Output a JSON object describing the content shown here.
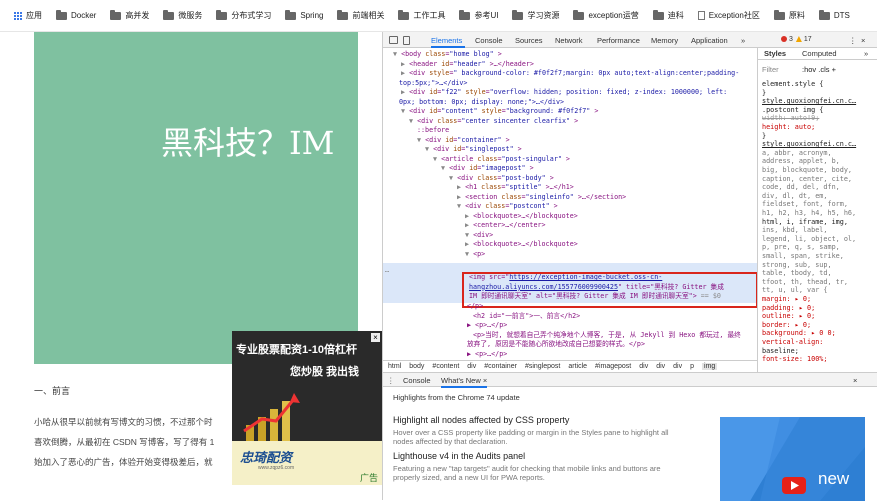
{
  "bookmarks": [
    {
      "label": "应用",
      "icon": "apps-grid-icon"
    },
    {
      "label": "Docker",
      "icon": "folder-icon"
    },
    {
      "label": "高并发",
      "icon": "folder-icon"
    },
    {
      "label": "微服务",
      "icon": "folder-icon"
    },
    {
      "label": "分布式学习",
      "icon": "folder-icon"
    },
    {
      "label": "Spring",
      "icon": "folder-icon"
    },
    {
      "label": "前端相关",
      "icon": "folder-icon"
    },
    {
      "label": "工作工具",
      "icon": "folder-icon"
    },
    {
      "label": "参考UI",
      "icon": "folder-icon"
    },
    {
      "label": "学习资源",
      "icon": "folder-icon"
    },
    {
      "label": "exception运营",
      "icon": "folder-icon"
    },
    {
      "label": "迪科",
      "icon": "folder-icon"
    },
    {
      "label": "Exception社区",
      "icon": "page-icon"
    },
    {
      "label": "原料",
      "icon": "folder-icon"
    },
    {
      "label": "DTS",
      "icon": "folder-icon"
    }
  ],
  "page": {
    "hero_title": "黑科技？IM",
    "section_heading": "一、前言",
    "paragraphs": [
      "小哈从很早以前就有写博文的习惯，不过那个时",
      "喜欢倒腾，从最初在 CSDN 写博客，写了得有 1",
      "始加入了恶心的广告，体验开始变得极差后，就"
    ],
    "colors": {
      "hero_bg": "#7fc1a0"
    }
  },
  "ad": {
    "line1": "专业股票配资1-10倍杠杆",
    "line2": "您炒股 我出钱",
    "brand": "忠琦配资",
    "url": "www.zqpz6.com",
    "tag": "广告",
    "close": "×"
  },
  "devtools": {
    "tabs": [
      "Elements",
      "Console",
      "Sources",
      "Network",
      "Performance",
      "Memory",
      "Application",
      "»"
    ],
    "active_tab": "Elements",
    "errors": "3",
    "warnings": "17",
    "more": "⋮",
    "close": "×",
    "elements_lines": [
      {
        "indent": 0,
        "arrow": "▼",
        "tag": "<body ",
        "attrs": [
          [
            "class",
            "\"home blog\""
          ]
        ],
        "tail": ">"
      },
      {
        "indent": 1,
        "arrow": "▶",
        "tag": "<header ",
        "attrs": [
          [
            "id",
            "\"header\""
          ]
        ],
        "tail": ">…</header>"
      },
      {
        "indent": 1,
        "arrow": "▶",
        "tag": "<div ",
        "attrs": [
          [
            "style",
            "\" background-color: #f0f2f7;margin: 0px auto;text-align:center;padding-"
          ]
        ],
        "tail": ""
      },
      {
        "indent": 0,
        "arrow": "",
        "tag": "",
        "attrs": [],
        "tail": "top:5px;\">…</div>",
        "plain": true
      },
      {
        "indent": 1,
        "arrow": "▶",
        "tag": "<div ",
        "attrs": [
          [
            "id",
            "\"f22\""
          ],
          [
            "style",
            "\"overflow: hidden; position: fixed; z-index: 1000000; left:"
          ]
        ],
        "tail": ""
      },
      {
        "indent": 0,
        "arrow": "",
        "tag": "",
        "attrs": [],
        "tail": "0px; bottom: 0px; display: none;\">…</div>",
        "plain": true
      },
      {
        "indent": 1,
        "arrow": "▼",
        "tag": "<div ",
        "attrs": [
          [
            "id",
            "\"content\""
          ],
          [
            "style",
            "\"background: #f0f2f7\""
          ]
        ],
        "tail": ">"
      },
      {
        "indent": 2,
        "arrow": "▼",
        "tag": "<div ",
        "attrs": [
          [
            "class",
            "\"center sincenter clearfix\""
          ]
        ],
        "tail": ">"
      },
      {
        "indent": 3,
        "arrow": "",
        "tag": "::before",
        "attrs": [],
        "tail": ""
      },
      {
        "indent": 3,
        "arrow": "▼",
        "tag": "<div ",
        "attrs": [
          [
            "id",
            "\"container\""
          ]
        ],
        "tail": ">"
      },
      {
        "indent": 4,
        "arrow": "▼",
        "tag": "<div ",
        "attrs": [
          [
            "id",
            "\"singlepost\""
          ]
        ],
        "tail": ">"
      },
      {
        "indent": 5,
        "arrow": "▼",
        "tag": "<article ",
        "attrs": [
          [
            "class",
            "\"post-singular\""
          ]
        ],
        "tail": ">"
      },
      {
        "indent": 6,
        "arrow": "▼",
        "tag": "<div ",
        "attrs": [
          [
            "id",
            "\"imagepost\""
          ]
        ],
        "tail": ">"
      },
      {
        "indent": 7,
        "arrow": "▼",
        "tag": "<div ",
        "attrs": [
          [
            "class",
            "\"post-body\""
          ]
        ],
        "tail": ">"
      },
      {
        "indent": 8,
        "arrow": "▶",
        "tag": "<h1 ",
        "attrs": [
          [
            "class",
            "\"sptitle\""
          ]
        ],
        "tail": ">…</h1>"
      },
      {
        "indent": 8,
        "arrow": "▶",
        "tag": "<section ",
        "attrs": [
          [
            "class",
            "\"singleinfo\""
          ]
        ],
        "tail": ">…</section>"
      },
      {
        "indent": 8,
        "arrow": "▼",
        "tag": "<div ",
        "attrs": [
          [
            "class",
            "\"postcont\""
          ]
        ],
        "tail": ">"
      },
      {
        "indent": 9,
        "arrow": "▶",
        "tag": "<blockquote>",
        "attrs": [],
        "tail": "…</blockquote>"
      },
      {
        "indent": 9,
        "arrow": "▶",
        "tag": "<center>",
        "attrs": [],
        "tail": "…</center>"
      },
      {
        "indent": 9,
        "arrow": "▼",
        "tag": "<div>",
        "attrs": [],
        "tail": ""
      },
      {
        "indent": 9,
        "arrow": "▶",
        "tag": "<blockquote>",
        "attrs": [],
        "tail": "…</blockquote>"
      },
      {
        "indent": 9,
        "arrow": "▼",
        "tag": "<p>",
        "attrs": [],
        "tail": ""
      }
    ],
    "img_line1_pre": "<img src=\"",
    "img_link1": "https://exception-image-bucket.oss-cn-",
    "img_link2": "hangzhou.aliyuncs.com/155776009900425",
    "img_line2_tail": "\" title=\"黑科技? Gitter 集成",
    "img_line3": "IM 即时通讯聊天室\" alt=\"黑科技? Gitter 集成 IM 即时通讯聊天室\">",
    "img_line3_eq": " == $0",
    "after_lines": [
      "</p>",
      "<h2 id=\"一前言\">一、前言</h2>",
      "▶ <p>…</p>",
      "<p>当时, 就想着自己弄个纯净地个人博客, 于是, 从 Jekyll 到 Hexo 都玩过, 最终",
      "放弃了, 原因是不能随心所欲地改成自己想要的样式。</p>",
      "▶ <p>…</p>",
      "▶ <p>…</p>",
      "<p>好了, 说了这么多废话, 开始进入正题. 由于网站有留言, 聊天的功能, 导致与很多"
    ],
    "breadcrumbs": [
      "html",
      "body",
      "#content",
      "div",
      "#container",
      "#singlepost",
      "article",
      "#imagepost",
      "div",
      "div",
      "div",
      "p",
      "img"
    ],
    "styles": {
      "tabs": [
        "Styles",
        "Computed",
        "»"
      ],
      "filter_placeholder": "Filter",
      "hov_cls": ":hov  .cls  +",
      "lines": [
        {
          "t": "element.style {",
          "c": "tx"
        },
        {
          "t": "}",
          "c": "tx"
        },
        {
          "t": "style.guoxiongfei.cn.c…",
          "c": "lnk"
        },
        {
          "t": ".postcont img {",
          "c": "tx"
        },
        {
          "t": "  width: auto!9;",
          "c": "strike"
        },
        {
          "t": "  height: auto;",
          "c": "prop"
        },
        {
          "t": "}",
          "c": "tx"
        },
        {
          "t": "style.guoxiongfei.cn.c…",
          "c": "lnk"
        },
        {
          "t": "a, abbr, acronym,",
          "c": "gr"
        },
        {
          "t": "address, applet, b,",
          "c": "gr"
        },
        {
          "t": "big, blockquote, body,",
          "c": "gr"
        },
        {
          "t": "caption, center, cite,",
          "c": "gr"
        },
        {
          "t": "code, dd, del, dfn,",
          "c": "gr"
        },
        {
          "t": "div, dl, dt, em,",
          "c": "gr"
        },
        {
          "t": "fieldset, font, form,",
          "c": "gr"
        },
        {
          "t": "h1, h2, h3, h4, h5, h6,",
          "c": "gr"
        },
        {
          "t": "html, i, iframe, img,",
          "c": "tx"
        },
        {
          "t": "ins, kbd, label,",
          "c": "gr"
        },
        {
          "t": "legend, li, object, ol,",
          "c": "gr"
        },
        {
          "t": "p, pre, q, s, samp,",
          "c": "gr"
        },
        {
          "t": "small, span, strike,",
          "c": "gr"
        },
        {
          "t": "strong, sub, sup,",
          "c": "gr"
        },
        {
          "t": "table, tbody, td,",
          "c": "gr"
        },
        {
          "t": "tfoot, th, thead, tr,",
          "c": "gr"
        },
        {
          "t": "tt, u, ul, var {",
          "c": "gr"
        },
        {
          "t": "  margin: ▸ 0;",
          "c": "prop"
        },
        {
          "t": "  padding: ▸ 0;",
          "c": "prop"
        },
        {
          "t": "  outline: ▸ 0;",
          "c": "prop"
        },
        {
          "t": "  border: ▸ 0;",
          "c": "prop"
        },
        {
          "t": "  background: ▸ 0 0;",
          "c": "prop"
        },
        {
          "t": "  vertical-align:",
          "c": "prop"
        },
        {
          "t": "      baseline;",
          "c": "tx"
        },
        {
          "t": "  font-size: 100%;",
          "c": "prop"
        }
      ]
    },
    "drawer": {
      "tabs": [
        "Console",
        "What's New ×"
      ],
      "heading": "Highlights from the Chrome 74 update",
      "features": [
        {
          "title": "Highlight all nodes affected by CSS property",
          "desc": [
            "Hover over a CSS property like padding or margin in the Styles pane to highlight all",
            "nodes affected by that declaration."
          ]
        },
        {
          "title": "Lighthouse v4 in the Audits panel",
          "desc": [
            "Featuring a new \"tap targets\" audit for checking that mobile links and buttons are",
            "properly sized, and a new UI for PWA reports."
          ]
        }
      ],
      "thumb_text": "new",
      "close": "×"
    }
  }
}
